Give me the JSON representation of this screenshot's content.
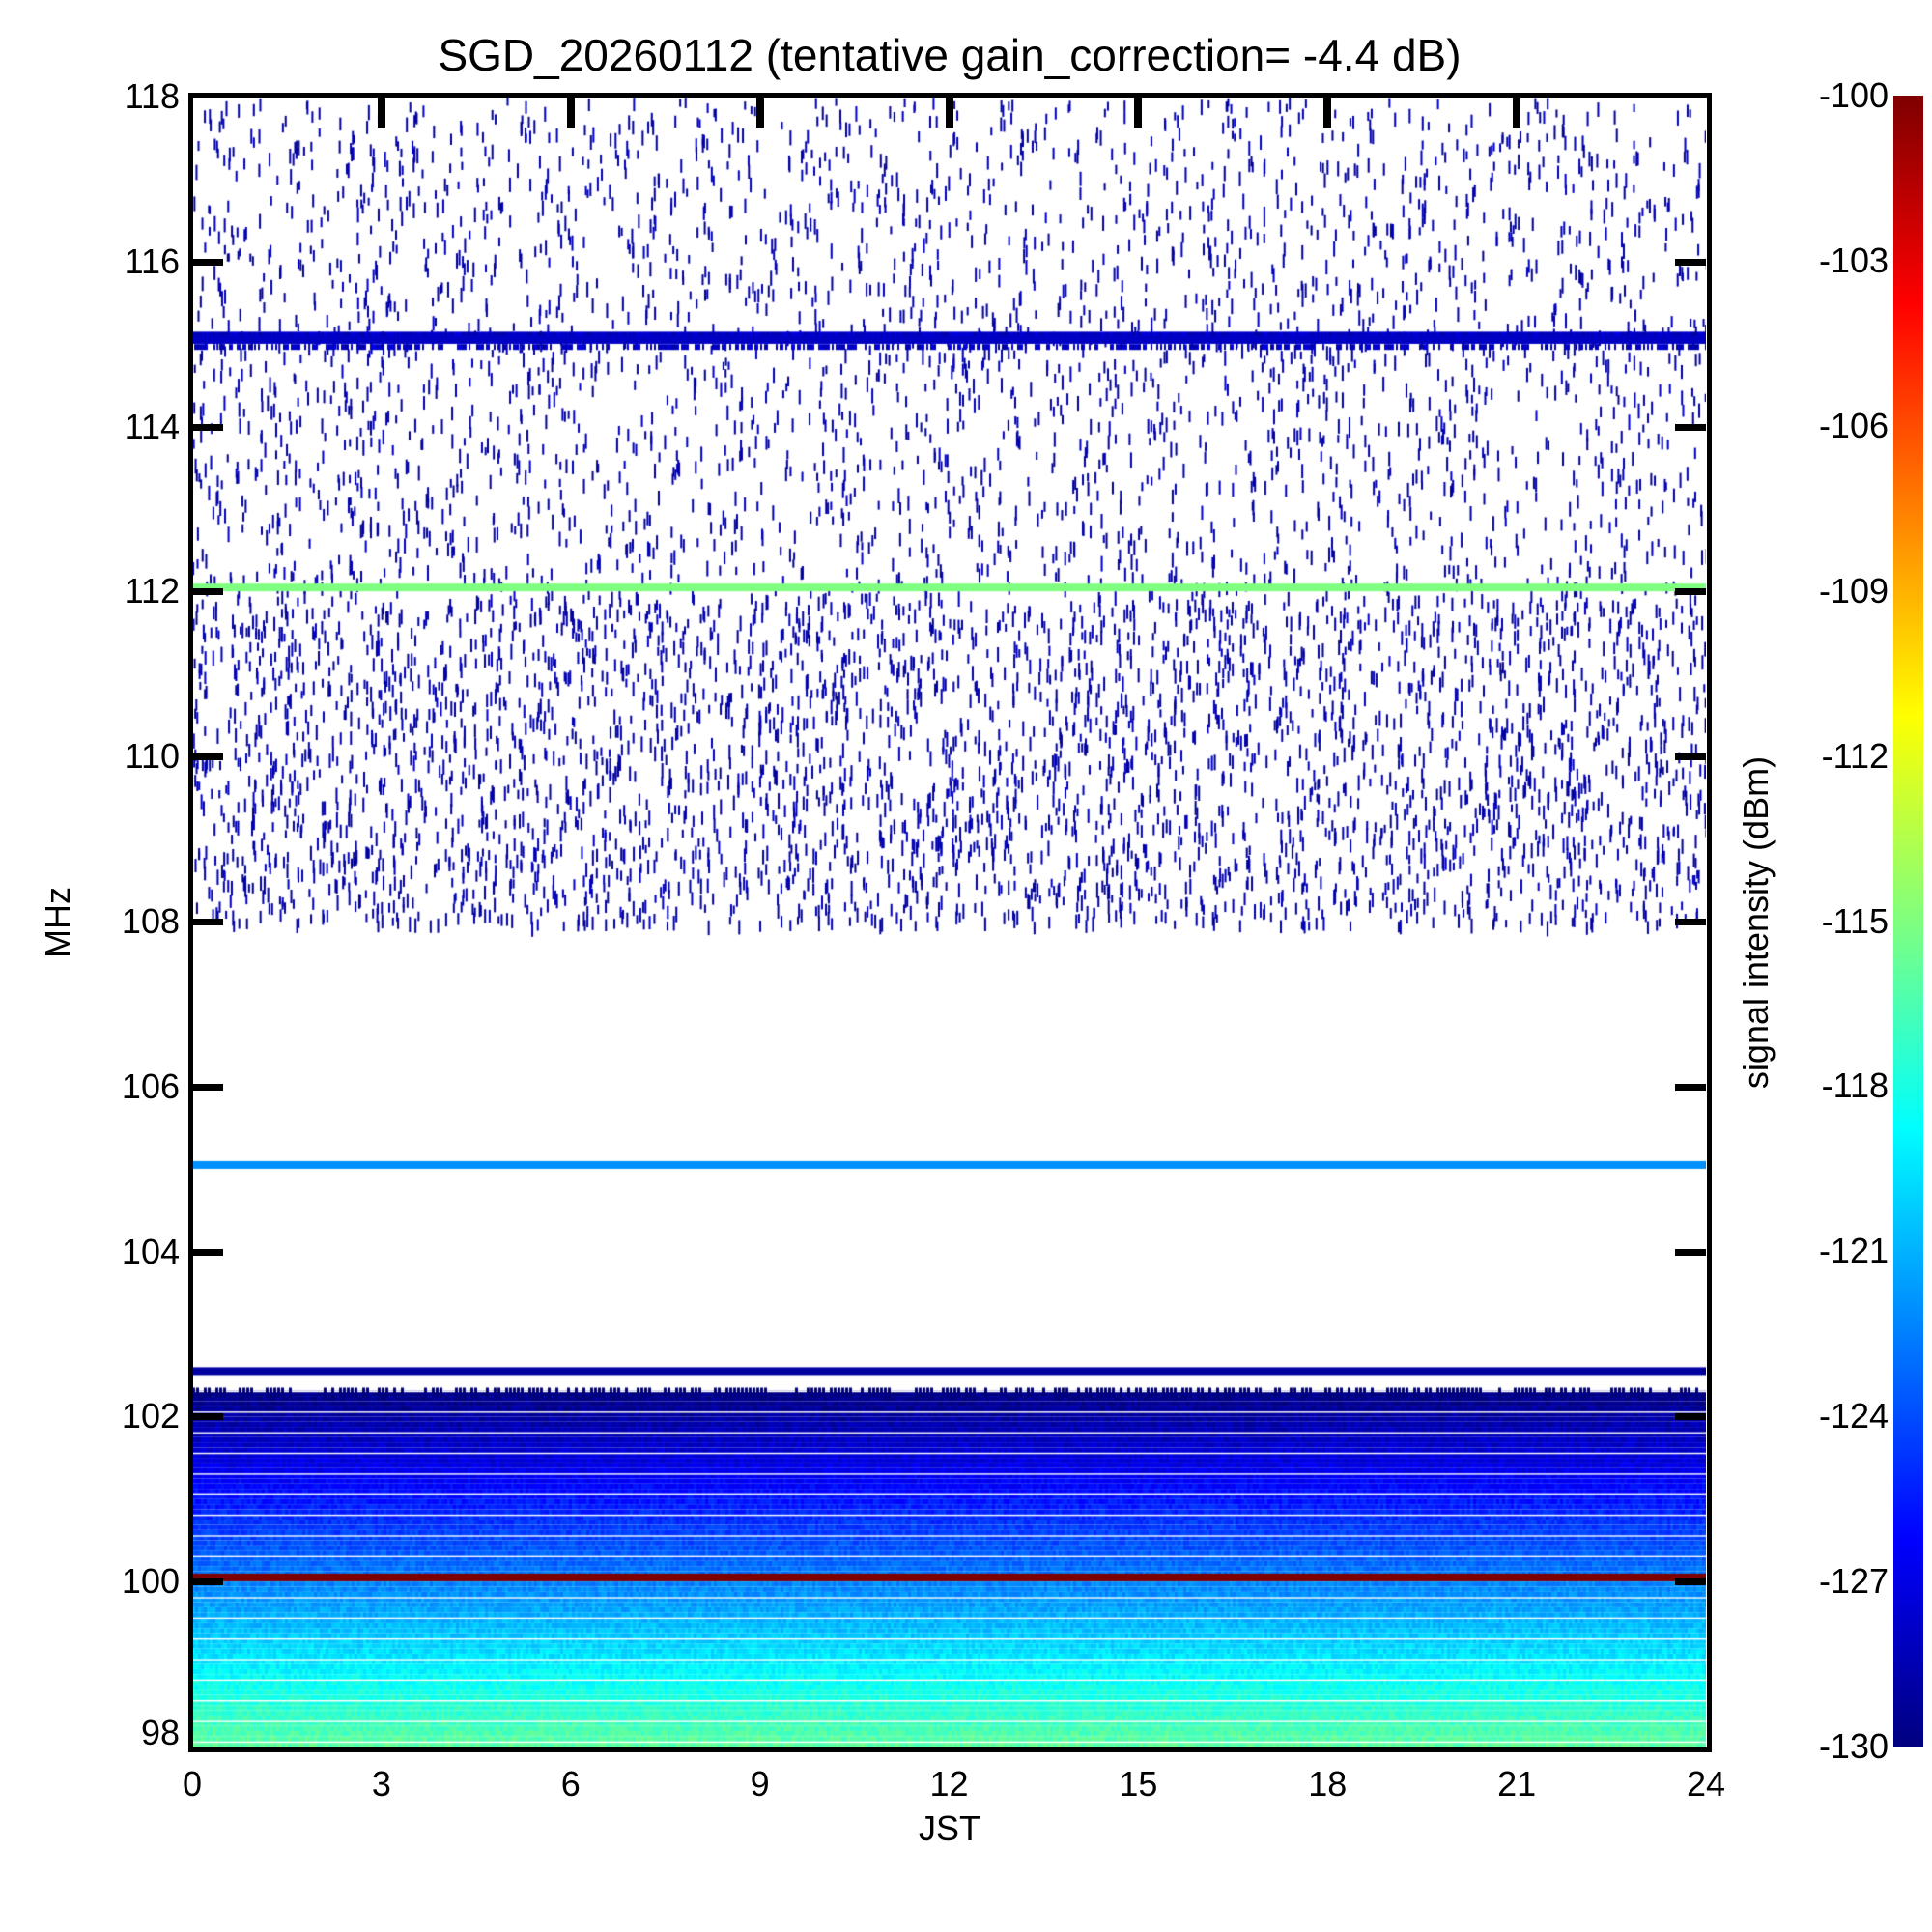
{
  "chart_data": {
    "type": "heatmap",
    "title": "SGD_20260112 (tentative gain_correction= -4.4 dB)",
    "xlabel": "JST",
    "ylabel": "MHz",
    "xlim": [
      0,
      24
    ],
    "ylim": [
      98,
      118
    ],
    "xticks": [
      "0",
      "3",
      "6",
      "9",
      "12",
      "15",
      "18",
      "21",
      "24"
    ],
    "yticks": [
      "98",
      "100",
      "102",
      "104",
      "106",
      "108",
      "110",
      "112",
      "114",
      "116",
      "118"
    ],
    "colorbar": {
      "label": "signal intensity (dBm)",
      "range": [
        -130,
        -100
      ],
      "ticks": [
        "-100",
        "-103",
        "-106",
        "-109",
        "-112",
        "-115",
        "-118",
        "-121",
        "-124",
        "-127",
        "-130"
      ],
      "colormap": "jet"
    },
    "features": [
      {
        "freq_mhz": 115.05,
        "dbm": -128,
        "kind": "continuous line"
      },
      {
        "freq_mhz": 112.05,
        "dbm": -115,
        "kind": "continuous line"
      },
      {
        "freq_mhz": 105.05,
        "dbm": -122,
        "kind": "continuous line"
      },
      {
        "freq_mhz": 102.55,
        "dbm": -129,
        "kind": "continuous line"
      },
      {
        "freq_mhz": 100.05,
        "dbm": -100,
        "kind": "continuous line"
      },
      {
        "freq_range_mhz": [
          98,
          102.3
        ],
        "dbm_range": [
          -116,
          -130
        ],
        "kind": "broadband gradient"
      },
      {
        "freq_range_mhz": [
          108,
          118
        ],
        "dbm": -130,
        "kind": "sparse intermittent noise"
      }
    ]
  }
}
